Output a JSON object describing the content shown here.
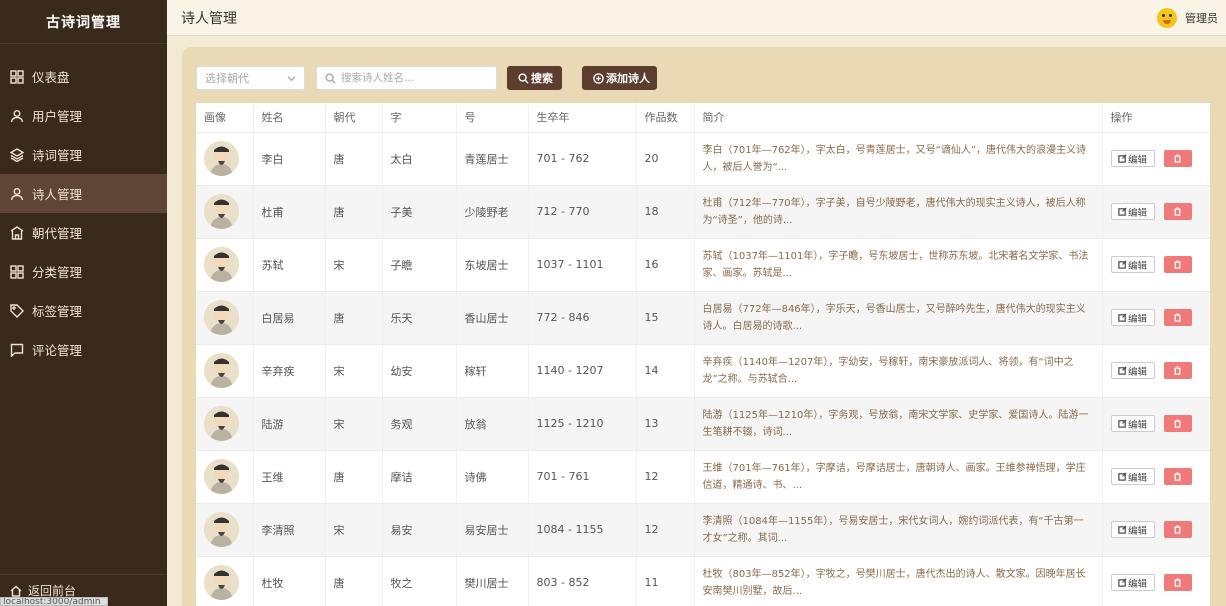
{
  "sidebar": {
    "logo": "古诗词管理",
    "items": [
      {
        "label": "仪表盘",
        "icon": "dashboard-icon"
      },
      {
        "label": "用户管理",
        "icon": "user-icon"
      },
      {
        "label": "诗词管理",
        "icon": "layers-icon"
      },
      {
        "label": "诗人管理",
        "icon": "user-icon",
        "active": true
      },
      {
        "label": "朝代管理",
        "icon": "building-icon"
      },
      {
        "label": "分类管理",
        "icon": "grid-icon"
      },
      {
        "label": "标签管理",
        "icon": "tag-icon"
      },
      {
        "label": "评论管理",
        "icon": "comment-icon"
      }
    ],
    "back_label": "返回前台",
    "status_url": "localhost:3000/admin"
  },
  "header": {
    "title": "诗人管理",
    "user_label": "管理员"
  },
  "toolbar": {
    "dynasty_placeholder": "选择朝代",
    "search_placeholder": "搜索诗人姓名...",
    "search_label": "搜索",
    "add_label": "添加诗人"
  },
  "table": {
    "headers": [
      "画像",
      "姓名",
      "朝代",
      "字",
      "号",
      "生卒年",
      "作品数",
      "简介",
      "操作"
    ],
    "edit_label": "编辑",
    "rows": [
      {
        "name": "李白",
        "dynasty": "唐",
        "zi": "太白",
        "hao": "青莲居士",
        "years": "701 - 762",
        "works": "20",
        "intro": "李白（701年—762年），字太白，号青莲居士，又号“谪仙人”，唐代伟大的浪漫主义诗人，被后人誉为“..."
      },
      {
        "name": "杜甫",
        "dynasty": "唐",
        "zi": "子美",
        "hao": "少陵野老",
        "years": "712 - 770",
        "works": "18",
        "intro": "杜甫（712年—770年），字子美，自号少陵野老，唐代伟大的现实主义诗人，被后人称为“诗圣”，他的诗..."
      },
      {
        "name": "苏轼",
        "dynasty": "宋",
        "zi": "子瞻",
        "hao": "东坡居士",
        "years": "1037 - 1101",
        "works": "16",
        "intro": "苏轼（1037年—1101年），字子瞻，号东坡居士，世称苏东坡。北宋著名文学家、书法家、画家。苏轼是..."
      },
      {
        "name": "白居易",
        "dynasty": "唐",
        "zi": "乐天",
        "hao": "香山居士",
        "years": "772 - 846",
        "works": "15",
        "intro": "白居易（772年—846年），字乐天，号香山居士，又号醉吟先生，唐代伟大的现实主义诗人。白居易的诗歌..."
      },
      {
        "name": "辛弃疾",
        "dynasty": "宋",
        "zi": "幼安",
        "hao": "稼轩",
        "years": "1140 - 1207",
        "works": "14",
        "intro": "辛弃疾（1140年—1207年），字幼安，号稼轩，南宋豪放派词人、将领，有“词中之龙”之称。与苏轼合..."
      },
      {
        "name": "陆游",
        "dynasty": "宋",
        "zi": "务观",
        "hao": "放翁",
        "years": "1125 - 1210",
        "works": "13",
        "intro": "陆游（1125年—1210年），字务观，号放翁，南宋文学家、史学家、爱国诗人。陆游一生笔耕不辍，诗词..."
      },
      {
        "name": "王维",
        "dynasty": "唐",
        "zi": "摩诘",
        "hao": "诗佛",
        "years": "701 - 761",
        "works": "12",
        "intro": "王维（701年—761年），字摩诘，号摩诘居士，唐朝诗人、画家。王维参禅悟理，学庄信道，精通诗、书、..."
      },
      {
        "name": "李清照",
        "dynasty": "宋",
        "zi": "易安",
        "hao": "易安居士",
        "years": "1084 - 1155",
        "works": "12",
        "intro": "李清照（1084年—1155年），号易安居士，宋代女词人，婉约词派代表，有“千古第一才女”之称。其词..."
      },
      {
        "name": "杜牧",
        "dynasty": "唐",
        "zi": "牧之",
        "hao": "樊川居士",
        "years": "803 - 852",
        "works": "11",
        "intro": "杜牧（803年—852年），字牧之，号樊川居士，唐代杰出的诗人、散文家。因晚年居长安南樊川别墅，故后..."
      }
    ]
  }
}
